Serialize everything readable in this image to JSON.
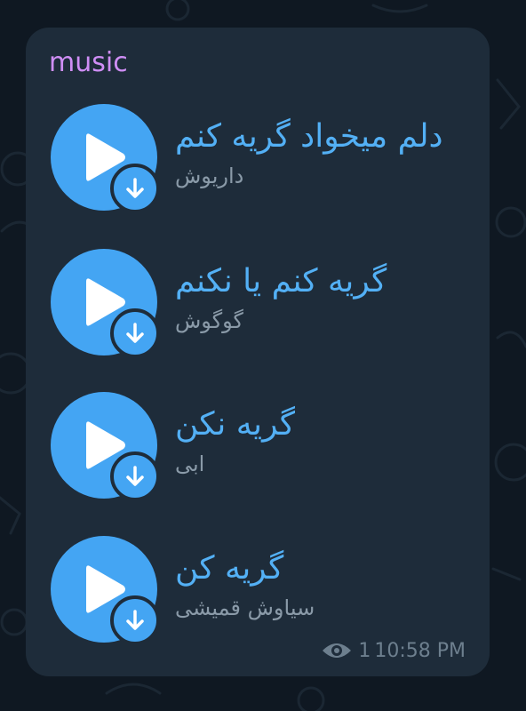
{
  "message": {
    "sender": "music",
    "tracks": [
      {
        "title": "دلم میخواد گریه کنم",
        "artist": "داریوش"
      },
      {
        "title": "گریه کنم یا نکنم",
        "artist": "گوگوش"
      },
      {
        "title": "گریه نکن",
        "artist": "ابی"
      },
      {
        "title": "گریه کن",
        "artist": "سیاوش قمیشی"
      }
    ],
    "views": "1",
    "time": "10:58 PM"
  },
  "icons": {
    "play": "play-icon",
    "download": "download-icon",
    "views": "eye-icon"
  },
  "colors": {
    "background": "#0f1822",
    "bubble": "#1e2c3a",
    "accent": "#44a5f3",
    "title": "#53b0f5",
    "sender": "#cf8ef5",
    "secondary_text": "#8a9aa8"
  }
}
